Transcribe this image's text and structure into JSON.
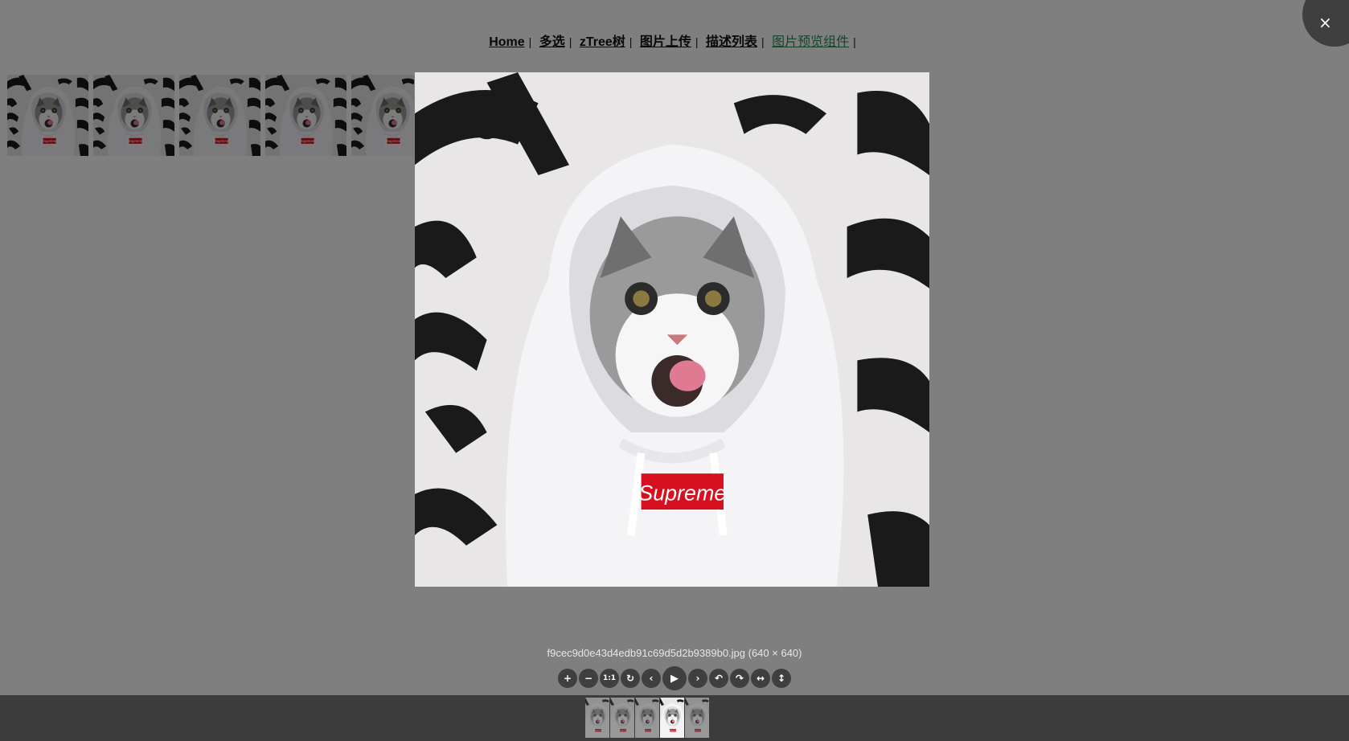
{
  "page_nav": {
    "links": [
      {
        "label": "Home"
      },
      {
        "label": "多选"
      },
      {
        "label": "zTree树"
      },
      {
        "label": "图片上传"
      },
      {
        "label": "描述列表"
      },
      {
        "label": "图片预览组件"
      }
    ],
    "separator": "|",
    "active_index": 5
  },
  "gallery": {
    "thumb_count": 5,
    "image_text": "Supreme"
  },
  "viewer": {
    "close_icon": "×",
    "caption": "f9cec9d0e43d4edb91c69d5d2b9389b0.jpg (640 × 640)",
    "toolbar": [
      {
        "name": "zoom-in-button",
        "icon": "plus-icon",
        "glyph": "+"
      },
      {
        "name": "zoom-out-button",
        "icon": "minus-icon",
        "glyph": "−"
      },
      {
        "name": "one-to-one-button",
        "icon": "one-to-one-icon",
        "glyph": "1:1"
      },
      {
        "name": "reset-button",
        "icon": "reset-icon",
        "glyph": "↻"
      },
      {
        "name": "prev-button",
        "icon": "chevron-left-icon",
        "glyph": "‹"
      },
      {
        "name": "play-button",
        "icon": "play-icon",
        "glyph": "▶"
      },
      {
        "name": "next-button",
        "icon": "chevron-right-icon",
        "glyph": "›"
      },
      {
        "name": "rotate-left-button",
        "icon": "rotate-left-icon",
        "glyph": "↶"
      },
      {
        "name": "rotate-right-button",
        "icon": "rotate-right-icon",
        "glyph": "↷"
      },
      {
        "name": "flip-horizontal-button",
        "icon": "flip-horizontal-icon",
        "glyph": "↔"
      },
      {
        "name": "flip-vertical-button",
        "icon": "flip-vertical-icon",
        "glyph": "↕"
      }
    ],
    "navbar_count": 5,
    "navbar_active_index": 3
  },
  "colors": {
    "backdrop": "rgba(0,0,0,0.5)",
    "navbar_bg": "#3c3c3c",
    "active_link": "#2e8b57",
    "supreme_red": "#d6101e"
  }
}
